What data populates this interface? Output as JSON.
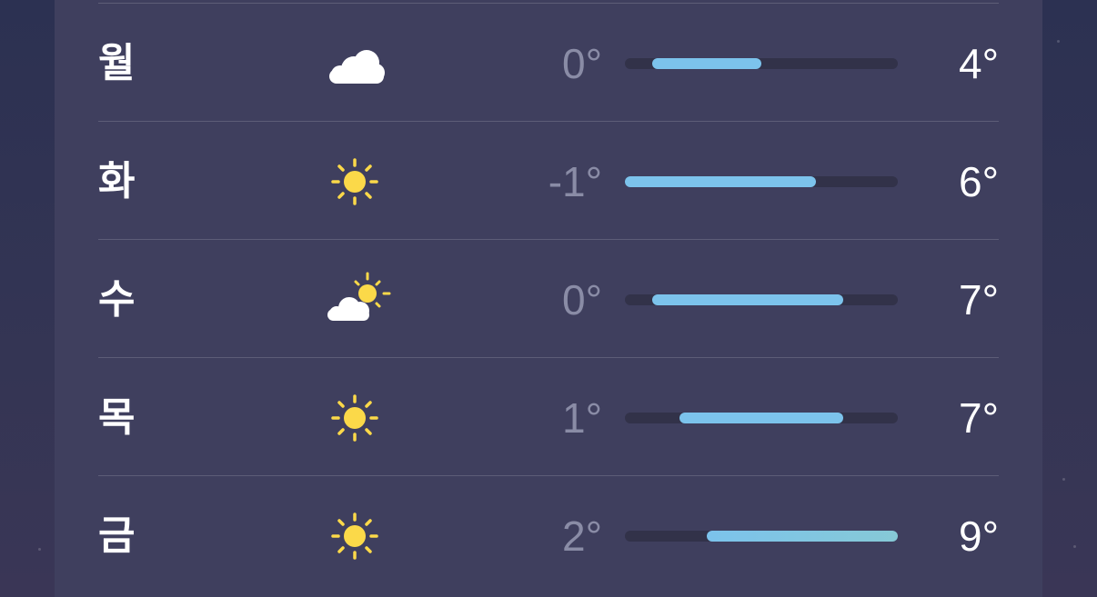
{
  "forecast": {
    "scale": {
      "min": -1,
      "max": 9
    },
    "days": [
      {
        "day": "월",
        "icon": "cloud-icon",
        "low": "0°",
        "high": "4°",
        "low_value": 0,
        "high_value": 4
      },
      {
        "day": "화",
        "icon": "sun-icon",
        "low": "-1°",
        "high": "6°",
        "low_value": -1,
        "high_value": 6
      },
      {
        "day": "수",
        "icon": "partly-cloudy-icon",
        "low": "0°",
        "high": "7°",
        "low_value": 0,
        "high_value": 7
      },
      {
        "day": "목",
        "icon": "sun-icon",
        "low": "1°",
        "high": "7°",
        "low_value": 1,
        "high_value": 7
      },
      {
        "day": "금",
        "icon": "sun-icon",
        "low": "2°",
        "high": "9°",
        "low_value": 2,
        "high_value": 9
      }
    ]
  },
  "colors": {
    "bar_cold": "#7cc3ec",
    "bar_warm": "#86c9d6",
    "sun": "#fbd949",
    "cloud": "#ffffff"
  }
}
